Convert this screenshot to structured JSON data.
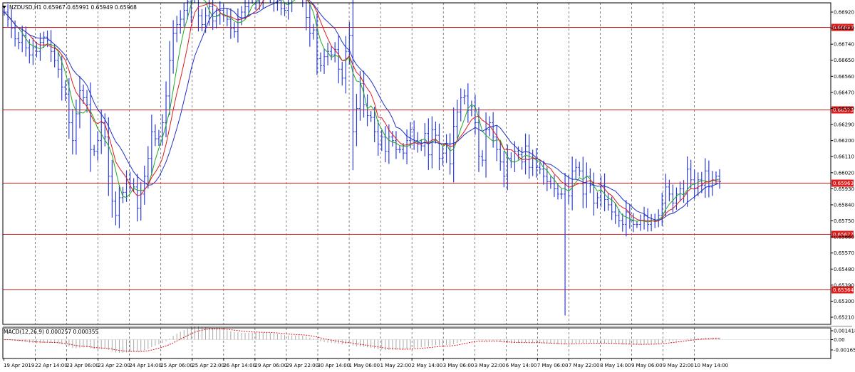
{
  "chart_header": {
    "symbol_line": "NZDUSD,H1  0.65967 0.65991 0.65949 0.65968"
  },
  "indicator_header": {
    "macd_line": "MACD(12,26,9) 0.000257 0.000355"
  },
  "colors": {
    "candle": "#2d3ed6",
    "ma_fast": "#1faa1f",
    "ma_mid": "#e01b1b",
    "ma_slow": "#2030c8",
    "level": "#e01b1b",
    "macd_signal": "#e01b1b",
    "macd_hist": "#a8a8a8",
    "grid": "#333333",
    "frame": "#000000"
  },
  "chart_data": [
    {
      "type": "line",
      "series": [
        {
          "values": [
            0.6692,
            0.6688,
            0.6683,
            0.6677,
            0.6675,
            0.6679,
            0.6672,
            0.6668,
            0.6672,
            0.667,
            0.6675,
            0.6678,
            0.6676,
            0.667,
            0.6665,
            0.666,
            0.665,
            0.6646,
            0.663,
            0.662,
            0.6635,
            0.6648,
            0.6644,
            0.664,
            0.6615,
            0.6614,
            0.662,
            0.663,
            0.6622,
            0.66,
            0.6586,
            0.6578,
            0.6588,
            0.6591,
            0.6598,
            0.6596,
            0.6594,
            0.6582,
            0.659,
            0.66,
            0.661,
            0.6625,
            0.6621,
            0.6622,
            0.663,
            0.6645,
            0.6665,
            0.668,
            0.6685,
            0.6688,
            0.6693,
            0.6698,
            0.672,
            0.6705,
            0.669,
            0.6685,
            0.669,
            0.6695,
            0.6687,
            0.669,
            0.6693,
            0.669,
            0.6688,
            0.6683,
            0.6681,
            0.6688,
            0.6692,
            0.6695,
            0.67,
            0.6703,
            0.6698,
            0.67,
            0.671,
            0.6707,
            0.6703,
            0.6697,
            0.6699,
            0.6694,
            0.6693,
            0.6697,
            0.6705,
            0.6706,
            0.6708,
            0.67,
            0.6689,
            0.668,
            0.6682,
            0.6666,
            0.6662,
            0.6667,
            0.667,
            0.6668,
            0.6671,
            0.666,
            0.6655,
            0.667,
            0.6679,
            0.6625,
            0.6638,
            0.6652,
            0.664,
            0.6634,
            0.6633,
            0.6625,
            0.6618,
            0.6622,
            0.6614,
            0.6622,
            0.662,
            0.6615,
            0.6615,
            0.6613,
            0.662,
            0.6626,
            0.662,
            0.6618,
            0.6617,
            0.6624,
            0.6612,
            0.6626,
            0.6623,
            0.661,
            0.6613,
            0.6618,
            0.6607,
            0.6628,
            0.6636,
            0.6644,
            0.6645,
            0.6637,
            0.6639,
            0.663,
            0.6611,
            0.6609,
            0.6626,
            0.663,
            0.6622,
            0.6615,
            0.6608,
            0.66,
            0.661,
            0.6608,
            0.6614,
            0.6612,
            0.6608,
            0.6617,
            0.6605,
            0.661,
            0.6605,
            0.6604,
            0.66,
            0.6597,
            0.6596,
            0.6593,
            0.659,
            0.659,
            0.6596,
            0.6589,
            0.6603,
            0.6605,
            0.6603,
            0.659,
            0.66,
            0.6595,
            0.6585,
            0.6588,
            0.6595,
            0.6587,
            0.6584,
            0.658,
            0.6578,
            0.6575,
            0.6573,
            0.658,
            0.6575,
            0.6573,
            0.6573,
            0.6575,
            0.6578,
            0.6573,
            0.6575,
            0.6575,
            0.6578,
            0.6585,
            0.6594,
            0.659,
            0.6585,
            0.659,
            0.6593,
            0.659,
            0.6604,
            0.6598,
            0.6593,
            0.6598,
            0.6595,
            0.6603,
            0.6594,
            0.6598,
            0.66,
            0.6597
          ]
        }
      ],
      "ylim": [
        0.6521,
        0.6692
      ],
      "yticks": [
        "0.66920",
        "0.66830",
        "0.66740",
        "0.66650",
        "0.66560",
        "0.66470",
        "0.66380",
        "0.66290",
        "0.66200",
        "0.66110",
        "0.66020",
        "0.65930",
        "0.65840",
        "0.65750",
        "0.65660",
        "0.65570",
        "0.65480",
        "0.65390",
        "0.65300",
        "0.65210"
      ],
      "level_labels": [
        "0.66837",
        "0.66373",
        "0.65963",
        "0.65677",
        "0.65364"
      ],
      "xticks": [
        "19 Apr 2019",
        "22 Apr 14:00",
        "23 Apr 06:00",
        "23 Apr 22:00",
        "24 Apr 14:00",
        "25 Apr 06:00",
        "25 Apr 22:00",
        "26 Apr 14:00",
        "29 Apr 06:00",
        "29 Apr 22:00",
        "30 Apr 14:00",
        "1 May 06:00",
        "1 May 22:00",
        "2 May 14:00",
        "3 May 06:00",
        "3 May 22:00",
        "6 May 14:00",
        "7 May 06:00",
        "7 May 22:00",
        "8 May 14:00",
        "9 May 06:00",
        "9 May 22:00",
        "10 May 14:00"
      ],
      "grid": true
    },
    {
      "type": "bar",
      "ylim": [
        -0.001651,
        0.001418
      ],
      "yticks": [
        "0.001418",
        "0.00",
        "-0.001651"
      ],
      "grid": true
    }
  ]
}
